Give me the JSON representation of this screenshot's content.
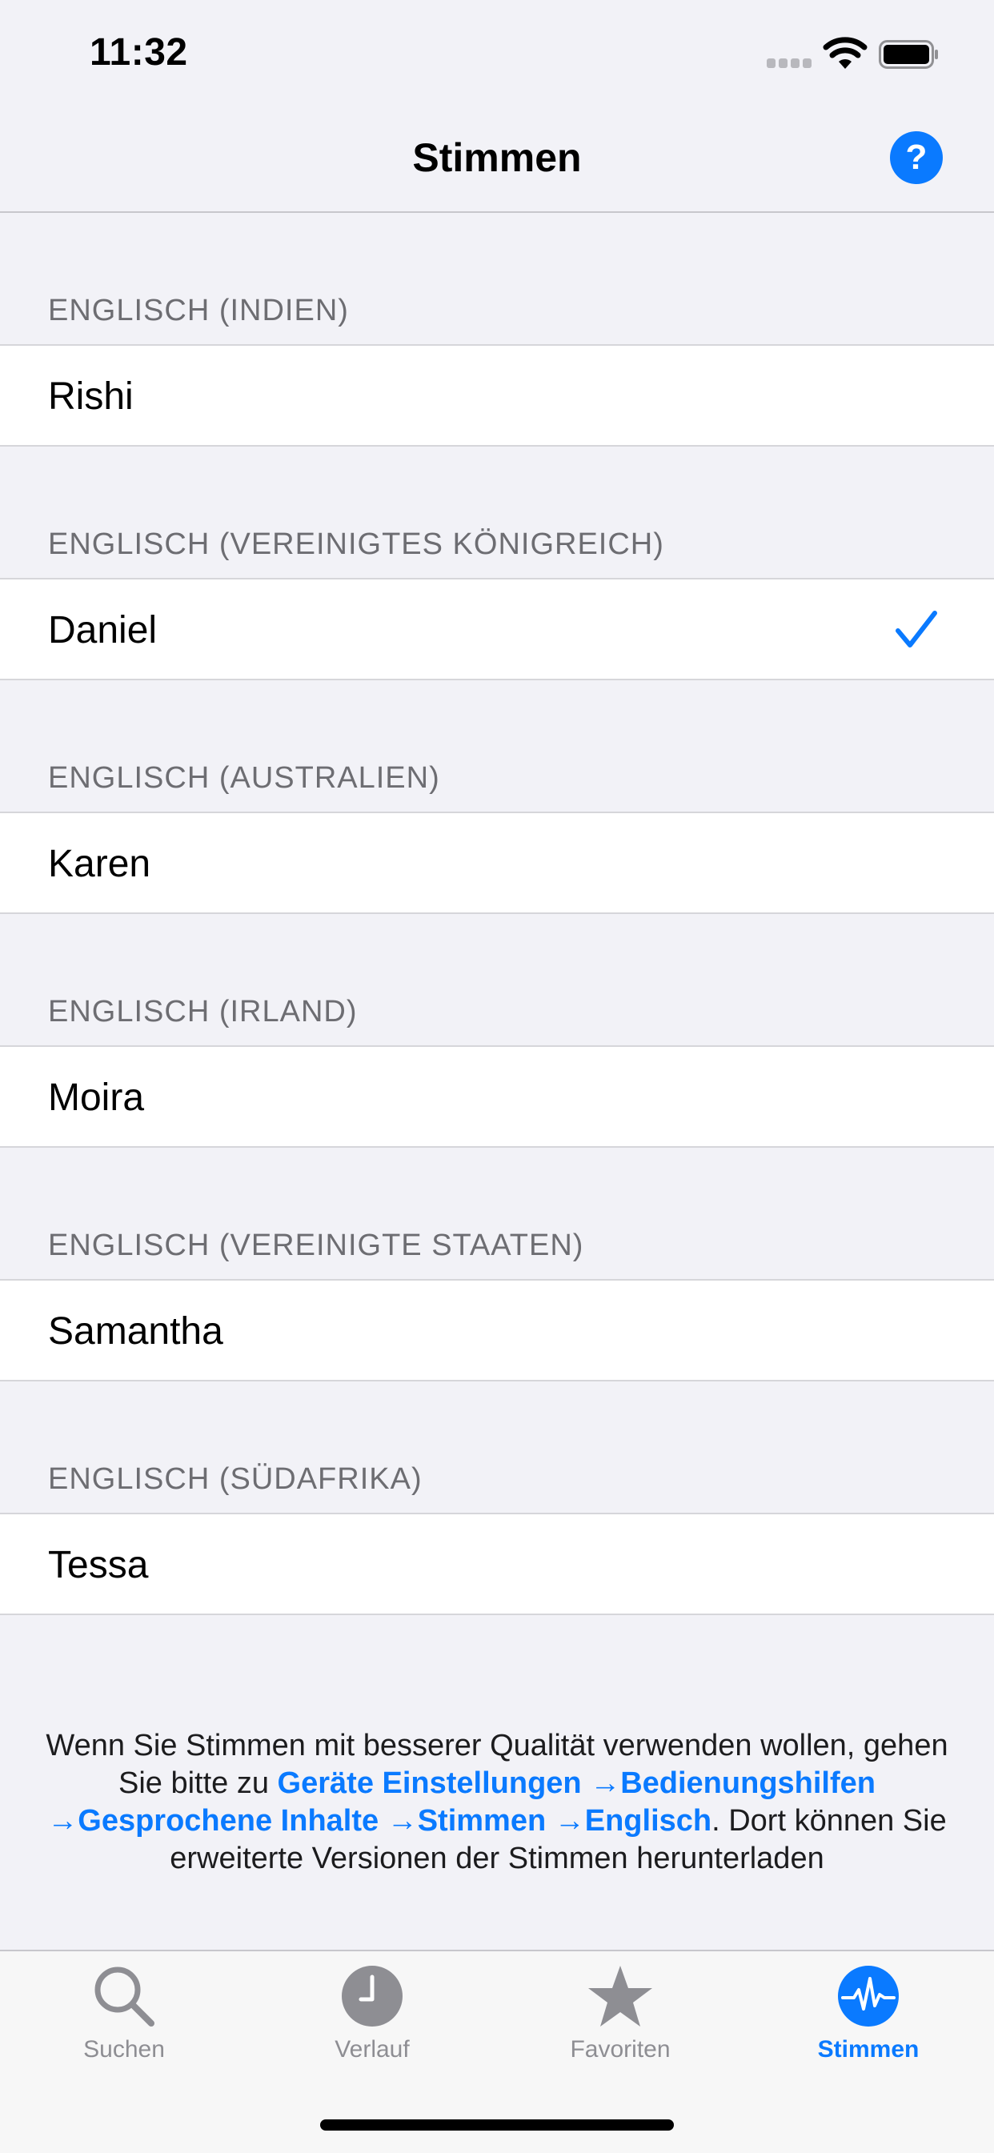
{
  "status_bar": {
    "time": "11:32"
  },
  "nav": {
    "title": "Stimmen",
    "help_label": "?"
  },
  "sections": [
    {
      "header": "ENGLISCH (INDIEN)",
      "voice": "Rishi",
      "selected": false
    },
    {
      "header": "ENGLISCH (VEREINIGTES KÖNIGREICH)",
      "voice": "Daniel",
      "selected": true
    },
    {
      "header": "ENGLISCH (AUSTRALIEN)",
      "voice": "Karen",
      "selected": false
    },
    {
      "header": "ENGLISCH (IRLAND)",
      "voice": "Moira",
      "selected": false
    },
    {
      "header": "ENGLISCH (VEREINIGTE STAATEN)",
      "voice": "Samantha",
      "selected": false
    },
    {
      "header": "ENGLISCH (SÜDAFRIKA)",
      "voice": "Tessa",
      "selected": false
    }
  ],
  "footer": {
    "text_1": "Wenn Sie Stimmen mit besserer Qualität verwenden wollen, gehen Sie bitte zu ",
    "link": "Geräte Einstellungen →Bedienungshilfen →Gesprochene Inhalte →Stimmen →Englisch",
    "text_2": ". Dort können Sie erweiterte Versionen der Stimmen herunterladen"
  },
  "tabs": [
    {
      "label": "Suchen",
      "icon": "search-icon",
      "active": false
    },
    {
      "label": "Verlauf",
      "icon": "clock-icon",
      "active": false
    },
    {
      "label": "Favoriten",
      "icon": "star-icon",
      "active": false
    },
    {
      "label": "Stimmen",
      "icon": "waveform-icon",
      "active": true
    }
  ],
  "colors": {
    "accent": "#0a7aff",
    "background": "#f2f2f7",
    "inactive": "#8e8e93"
  }
}
